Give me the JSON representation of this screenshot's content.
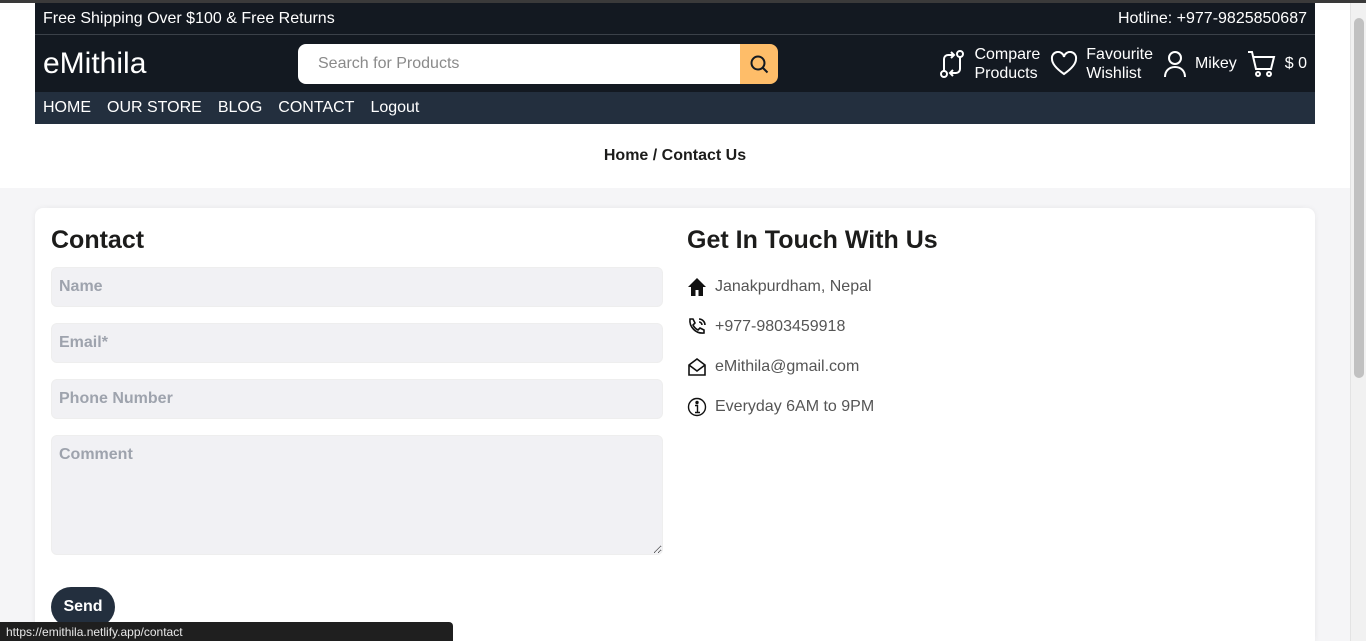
{
  "promo": {
    "left": "Free Shipping Over $100 & Free Returns",
    "right": "Hotline: +977-9825850687"
  },
  "header": {
    "logo": "eMithila",
    "search_placeholder": "Search for Products",
    "compare": {
      "line1": "Compare",
      "line2": "Products"
    },
    "wishlist": {
      "line1": "Favourite",
      "line2": "Wishlist"
    },
    "user": "Mikey",
    "cart_total": "$ 0"
  },
  "nav": [
    "HOME",
    "OUR STORE",
    "BLOG",
    "CONTACT",
    "Logout"
  ],
  "breadcrumb": "Home / Contact Us",
  "form": {
    "title": "Contact",
    "name_placeholder": "Name",
    "email_placeholder": "Email*",
    "phone_placeholder": "Phone Number",
    "comment_placeholder": "Comment",
    "send_label": "Send"
  },
  "info": {
    "title": "Get In Touch With Us",
    "address": "Janakpurdham, Nepal",
    "phone": "+977-9803459918",
    "email": "eMithila@gmail.com",
    "hours": "Everyday 6AM to 9PM"
  },
  "status_url": "https://emithila.netlify.app/contact",
  "colors": {
    "header_bg": "#131921",
    "nav_bg": "#232f3e",
    "search_btn": "#febd69"
  }
}
